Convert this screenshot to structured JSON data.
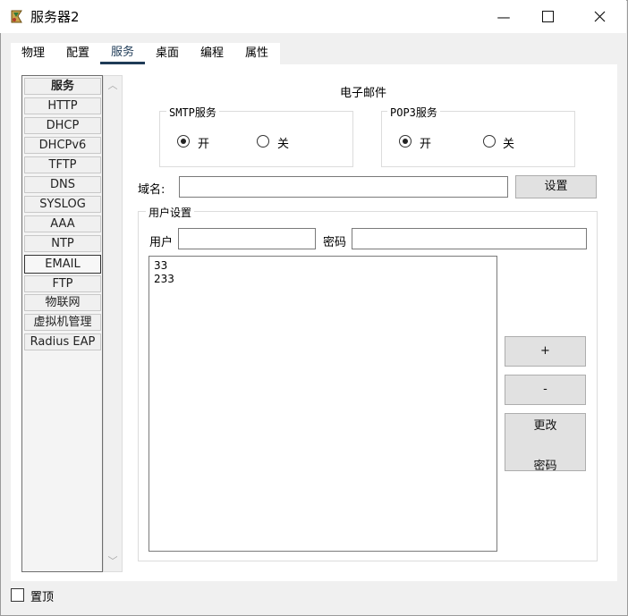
{
  "window": {
    "title": "服务器2",
    "minimize_glyph": "—",
    "maximize_glyph": "☐",
    "close_glyph": "✕"
  },
  "tabs": [
    {
      "label": "物理"
    },
    {
      "label": "配置"
    },
    {
      "label": "服务",
      "active": true
    },
    {
      "label": "桌面"
    },
    {
      "label": "编程"
    },
    {
      "label": "属性"
    }
  ],
  "services": {
    "header": "服务",
    "items": [
      "HTTP",
      "DHCP",
      "DHCPv6",
      "TFTP",
      "DNS",
      "SYSLOG",
      "AAA",
      "NTP",
      "EMAIL",
      "FTP",
      "物联网",
      "虚拟机管理",
      "Radius EAP"
    ],
    "selected": "EMAIL"
  },
  "email": {
    "title": "电子邮件",
    "smtp": {
      "label": "SMTP服务",
      "on_label": "开",
      "off_label": "关",
      "value": "开"
    },
    "pop3": {
      "label": "POP3服务",
      "on_label": "开",
      "off_label": "关",
      "value": "开"
    },
    "domain_label": "域名:",
    "domain_value": "",
    "set_button": "设置",
    "user_settings": {
      "label": "用户设置",
      "user_label": "用户",
      "user_value": "",
      "password_label": "密码",
      "password_value": "",
      "users": [
        "33",
        "233"
      ],
      "add_button": "+",
      "remove_button": "-",
      "change_button_line1": "更改",
      "change_button_line2": "密码"
    }
  },
  "footer": {
    "pin_label": "置顶",
    "pin_checked": false
  }
}
